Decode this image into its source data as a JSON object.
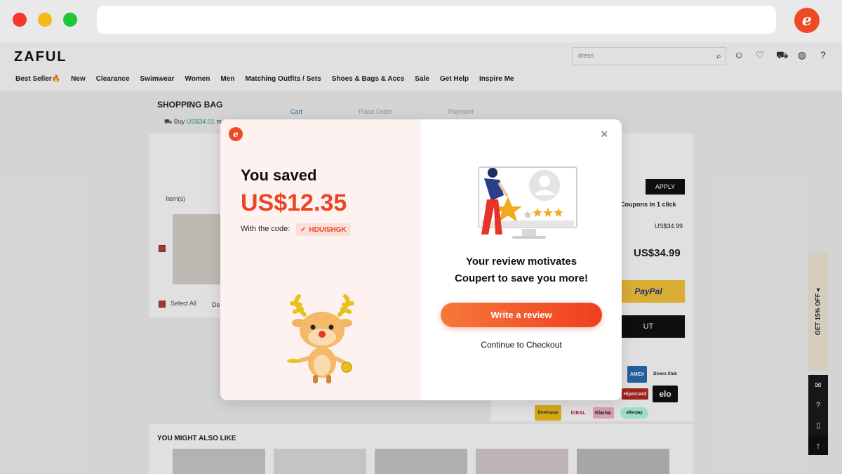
{
  "browser": {
    "extension_letter": "e"
  },
  "site": {
    "logo": "ZAFUL",
    "search_value": "dress",
    "nav": [
      "Best Seller🔥",
      "New",
      "Clearance",
      "Swimwear",
      "Women",
      "Men",
      "Matching Outfits / Sets",
      "Shoes & Bags & Accs",
      "Sale",
      "Get Help",
      "Inspire Me"
    ],
    "steps": [
      "Cart",
      "Place Order",
      "Payment"
    ],
    "bag_title": "SHOPPING BAG",
    "buy_prefix": "Buy",
    "buy_amount": "US$34.01",
    "buy_suffix": "m",
    "items_header": "Item(s)",
    "select_all": "Select All",
    "delete_partial": "De",
    "apply_label": "APPLY",
    "coupons_text": "Coupons in 1 click",
    "subtotal": "US$34.99",
    "total": "US$34.99",
    "paypal_label": "PayPal",
    "checkout_partial": "UT",
    "payment_methods": [
      "AMEX",
      "Diners Club",
      "Hipercard",
      "elo",
      "Boletopay",
      "iDEAL",
      "Klarna.",
      "afterpay"
    ],
    "ymal_title": "YOU MIGHT ALSO LIKE",
    "side_tab": "GET 15% OFF ◂"
  },
  "modal": {
    "logo_letter": "e",
    "saved_label": "You saved",
    "saved_amount": "US$12.35",
    "code_label": "With the code:",
    "code_value": "HDUISHGK",
    "close_symbol": "×",
    "message_line1": "Your review motivates",
    "message_line2": "Coupert to save you more!",
    "write_review_label": "Write a review",
    "continue_label": "Continue to Checkout",
    "accent_color": "#ea4524"
  }
}
